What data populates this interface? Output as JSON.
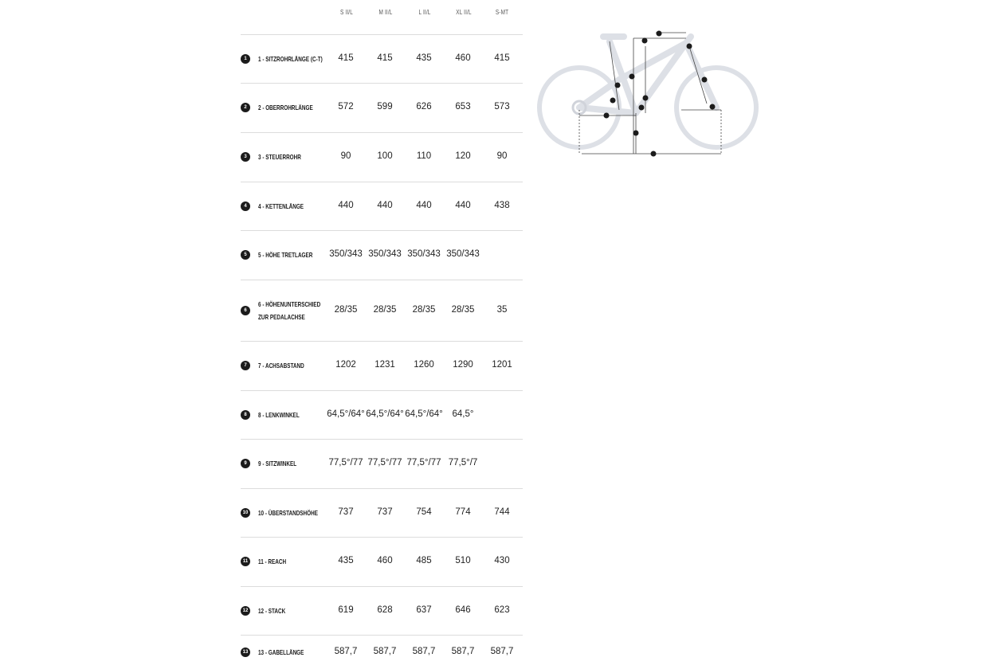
{
  "columns": [
    "S II/L",
    "M II/L",
    "L II/L",
    "XL II/L",
    "S-MT"
  ],
  "rows": [
    {
      "num": "1",
      "label": [
        "1 - SITZROHRLÄNGE (C-T)"
      ],
      "values": [
        "415",
        "415",
        "435",
        "460",
        "415"
      ]
    },
    {
      "num": "2",
      "label": [
        "2 - OBERROHRLÄNGE"
      ],
      "values": [
        "572",
        "599",
        "626",
        "653",
        "573"
      ]
    },
    {
      "num": "3",
      "label": [
        "3 - STEUERROHR"
      ],
      "values": [
        "90",
        "100",
        "110",
        "120",
        "90"
      ]
    },
    {
      "num": "4",
      "label": [
        "4 - KETTENLÄNGE"
      ],
      "values": [
        "440",
        "440",
        "440",
        "440",
        "438"
      ]
    },
    {
      "num": "5",
      "label": [
        "5 - HÖHE TRETLAGER"
      ],
      "values": [
        "350/343",
        "350/343",
        "350/343",
        "350/343",
        ""
      ]
    },
    {
      "num": "6",
      "label": [
        "6 - HÖHENUNTERSCHIED",
        "ZUR PEDALACHSE"
      ],
      "values": [
        "28/35",
        "28/35",
        "28/35",
        "28/35",
        "35"
      ]
    },
    {
      "num": "7",
      "label": [
        "7 - ACHSABSTAND"
      ],
      "values": [
        "1202",
        "1231",
        "1260",
        "1290",
        "1201"
      ]
    },
    {
      "num": "8",
      "label": [
        "8 - LENKWINKEL"
      ],
      "values": [
        "64,5°/64°",
        "64,5°/64°",
        "64,5°/64°",
        "64,5°",
        ""
      ]
    },
    {
      "num": "9",
      "label": [
        "9 - SITZWINKEL"
      ],
      "values": [
        "77,5°/77",
        "77,5°/77",
        "77,5°/77",
        "77,5°/7",
        ""
      ]
    },
    {
      "num": "10",
      "label": [
        "10 - ÜBERSTANDSHÖHE"
      ],
      "values": [
        "737",
        "737",
        "754",
        "774",
        "744"
      ]
    },
    {
      "num": "11",
      "label": [
        "11 - REACH"
      ],
      "values": [
        "435",
        "460",
        "485",
        "510",
        "430"
      ]
    },
    {
      "num": "12",
      "label": [
        "12 - STACK"
      ],
      "values": [
        "619",
        "628",
        "637",
        "646",
        "623"
      ]
    },
    {
      "num": "13",
      "label": [
        "13 - GABELLÄNGE"
      ],
      "values": [
        "587,7",
        "587,7",
        "587,7",
        "587,7",
        "587,7"
      ]
    }
  ],
  "diagram": {
    "markers": [
      "1",
      "2",
      "3",
      "4",
      "5",
      "6",
      "7",
      "8",
      "9",
      "10",
      "11",
      "12",
      "13"
    ],
    "colors": {
      "frame": "#dde0e6",
      "lines": "#444444",
      "marker": "#1b1b1b"
    }
  }
}
